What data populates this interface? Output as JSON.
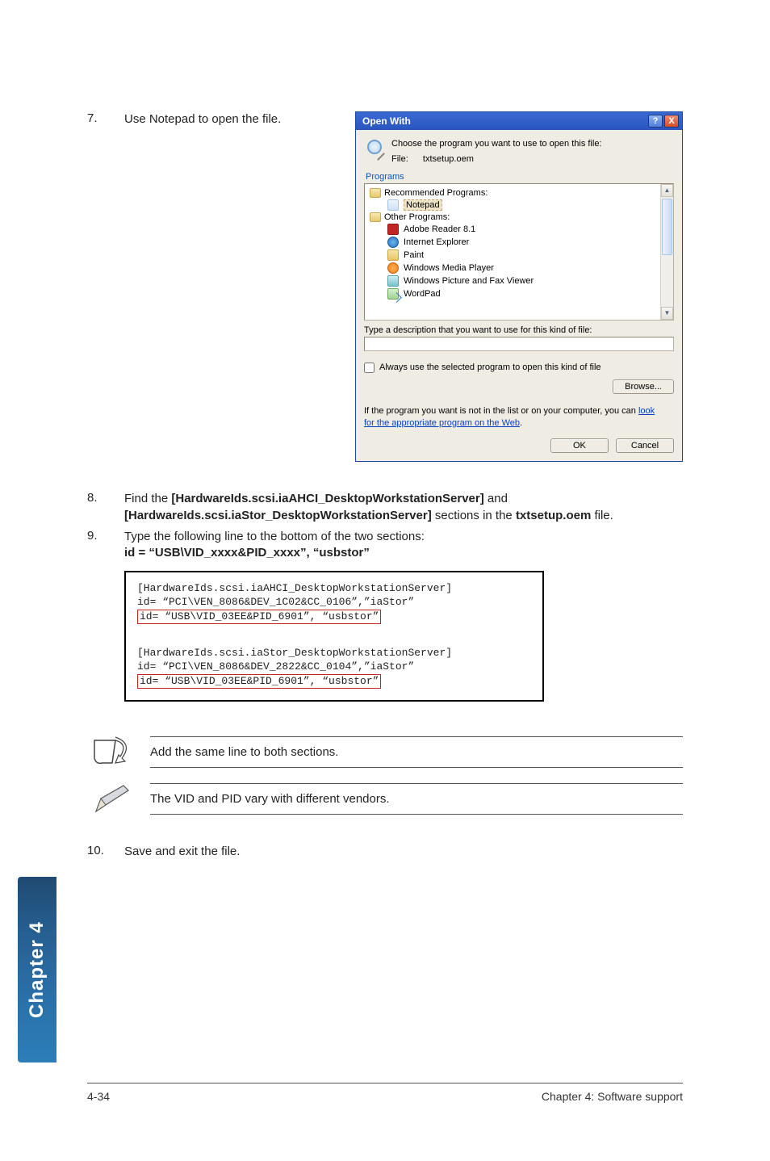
{
  "steps": {
    "s7": {
      "num": "7.",
      "text": "Use Notepad to open the file."
    },
    "s8": {
      "num": "8.",
      "pre": "Find the ",
      "b1": "[HardwareIds.scsi.iaAHCI_DesktopWorkstationServer]",
      "mid": " and ",
      "b2": "[HardwareIds.scsi.iaStor_DesktopWorkstationServer]",
      "post1": " sections in the ",
      "b3": "txtsetup.oem",
      "post2": " file."
    },
    "s9": {
      "num": "9.",
      "line1": "Type the following line to the bottom of the two sections:",
      "line2": "id = “USB\\VID_xxxx&PID_xxxx”, “usbstor”"
    },
    "s10": {
      "num": "10.",
      "text": "Save and exit the file."
    }
  },
  "dialog": {
    "title": "Open With",
    "msg_line1": "Choose the program you want to use to open this file:",
    "file_label": "File:",
    "file_name": "txtsetup.oem",
    "programs_label": "Programs",
    "group_rec": "Recommended Programs:",
    "group_other": "Other Programs:",
    "items": {
      "notepad": "Notepad",
      "adobe": "Adobe Reader 8.1",
      "ie": "Internet Explorer",
      "paint": "Paint",
      "wmp": "Windows Media Player",
      "picview": "Windows Picture and Fax Viewer",
      "wordpad": "WordPad"
    },
    "desc_label": "Type a description that you want to use for this kind of file:",
    "always_label": "Always use the selected program to open this kind of file",
    "browse": "Browse...",
    "link_pre": "If the program you want is not in the list or on your computer, you can ",
    "link1": "look",
    "link2": "for the appropriate program on the Web",
    "link_post": ".",
    "ok": "OK",
    "cancel": "Cancel",
    "help": "?",
    "close": "X"
  },
  "code": {
    "l1": "[HardwareIds.scsi.iaAHCI_DesktopWorkstationServer]",
    "l2": "id= “PCI\\VEN_8086&DEV_1C02&CC_0106”,”iaStor”",
    "l3": "id= “USB\\VID_03EE&PID_6901”, “usbstor”",
    "l4": "[HardwareIds.scsi.iaStor_DesktopWorkstationServer]",
    "l5": "id= “PCI\\VEN_8086&DEV_2822&CC_0104”,”iaStor”",
    "l6": "id= “USB\\VID_03EE&PID_6901”, “usbstor”"
  },
  "notes": {
    "n1": "Add the same line to both sections.",
    "n2": "The VID and PID vary with different vendors."
  },
  "tab": "Chapter 4",
  "footer": {
    "left": "4-34",
    "right": "Chapter 4: Software support"
  }
}
